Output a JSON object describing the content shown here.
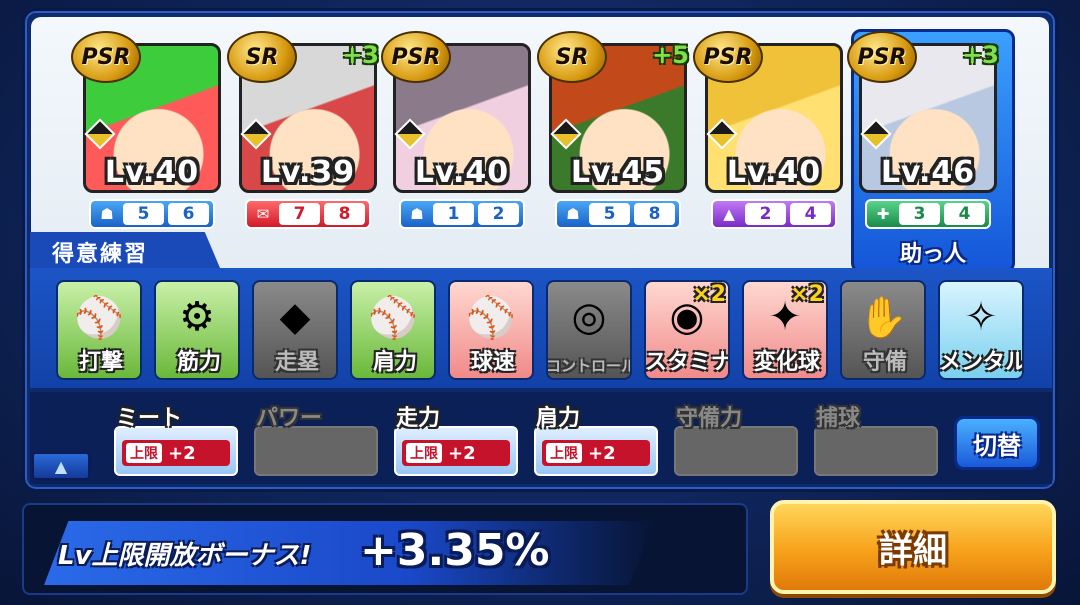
{
  "deck": {
    "cards": [
      {
        "rarity": "PSR",
        "plus": "",
        "level": "Lv.40",
        "type": "blue",
        "type_icon": "catcher-mask-icon",
        "nums": [
          "5",
          "6"
        ],
        "hair": "#3ccc3c",
        "bg": "#ff5a5a"
      },
      {
        "rarity": "SR",
        "plus": "+3",
        "level": "Lv.39",
        "type": "red",
        "type_icon": "gift-icon",
        "nums": [
          "7",
          "8"
        ],
        "hair": "#d8d8d8",
        "bg": "#d84848"
      },
      {
        "rarity": "PSR",
        "plus": "",
        "level": "Lv.40",
        "type": "blue",
        "type_icon": "catcher-mask-icon",
        "nums": [
          "1",
          "2"
        ],
        "hair": "#8a7a8a",
        "bg": "#f0d0e0"
      },
      {
        "rarity": "SR",
        "plus": "+5",
        "level": "Lv.45",
        "type": "blue",
        "type_icon": "catcher-mask-icon",
        "nums": [
          "5",
          "8"
        ],
        "hair": "#c24a1a",
        "bg": "#3a7a2a"
      },
      {
        "rarity": "PSR",
        "plus": "",
        "level": "Lv.40",
        "type": "purple",
        "type_icon": "tree-icon",
        "nums": [
          "2",
          "4"
        ],
        "hair": "#f0c23a",
        "bg": "#ffe070"
      },
      {
        "rarity": "PSR",
        "plus": "+3",
        "level": "Lv.46",
        "type": "green",
        "type_icon": "glove-icon",
        "nums": [
          "3",
          "4"
        ],
        "hair": "#e8e8ee",
        "bg": "#b8c8e0"
      }
    ],
    "helper_label": "助っ人"
  },
  "practice": {
    "tab_label": "得意練習",
    "tiles": [
      {
        "label": "打撃",
        "state": "on",
        "icon": "bat-icon",
        "glyph": "⚾",
        "mult": ""
      },
      {
        "label": "筋力",
        "state": "on",
        "icon": "dumbbell-icon",
        "glyph": "⚙",
        "mult": ""
      },
      {
        "label": "走塁",
        "state": "off",
        "icon": "base-icon",
        "glyph": "◆",
        "mult": ""
      },
      {
        "label": "肩力",
        "state": "on",
        "icon": "throw-arc-icon",
        "glyph": "⚾",
        "mult": ""
      },
      {
        "label": "球速",
        "state": "pink",
        "icon": "fastball-icon",
        "glyph": "⚾",
        "mult": ""
      },
      {
        "label": "コントロール",
        "state": "off",
        "icon": "target-icon",
        "glyph": "◎",
        "mult": ""
      },
      {
        "label": "スタミナ",
        "state": "pink",
        "icon": "tire-icon",
        "glyph": "◉",
        "mult": "×2"
      },
      {
        "label": "変化球",
        "state": "pink",
        "icon": "breaking-ball-icon",
        "glyph": "✦",
        "mult": "×2"
      },
      {
        "label": "守備",
        "state": "off",
        "icon": "glove-icon",
        "glyph": "✋",
        "mult": ""
      },
      {
        "label": "メンタル",
        "state": "cyan",
        "icon": "cloud-icon",
        "glyph": "✧",
        "mult": ""
      }
    ]
  },
  "limits": {
    "items": [
      {
        "name": "ミート",
        "active": true,
        "cap": "上限",
        "value": "+2",
        "icon": "bat-icon"
      },
      {
        "name": "パワー",
        "active": false,
        "cap": "",
        "value": "",
        "icon": "dumbbell-icon"
      },
      {
        "name": "走力",
        "active": true,
        "cap": "上限",
        "value": "+2",
        "icon": "runner-icon"
      },
      {
        "name": "肩力",
        "active": true,
        "cap": "上限",
        "value": "+2",
        "icon": "throw-arc-icon"
      },
      {
        "name": "守備力",
        "active": false,
        "cap": "",
        "value": "",
        "icon": "glove-icon"
      },
      {
        "name": "捕球",
        "active": false,
        "cap": "",
        "value": "",
        "icon": "ball-icon"
      }
    ],
    "switch_label": "切替",
    "collapse_glyph": "▲"
  },
  "bonus": {
    "label": "Lv上限開放ボーナス!",
    "value": "+3.35%"
  },
  "detail_button": "詳細"
}
